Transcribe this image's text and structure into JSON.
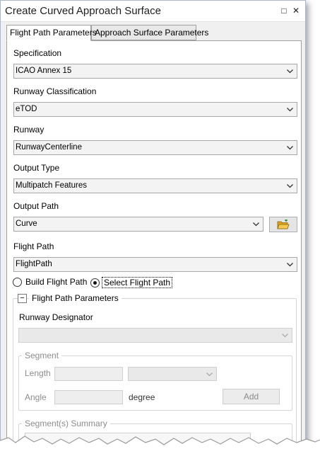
{
  "window": {
    "title": "Create Curved Approach Surface",
    "pin_glyph": "□",
    "close_glyph": "✕"
  },
  "tabs": [
    {
      "label": "Flight Path Parameters",
      "active": true
    },
    {
      "label": "Approach Surface Parameters",
      "active": false
    }
  ],
  "fields": {
    "specification": {
      "label": "Specification",
      "value": "ICAO Annex 15"
    },
    "runway_classification": {
      "label": "Runway Classification",
      "value": "eTOD"
    },
    "runway": {
      "label": "Runway",
      "value": "RunwayCenterline"
    },
    "output_type": {
      "label": "Output Type",
      "value": "Multipatch Features"
    },
    "output_path": {
      "label": "Output Path",
      "value": "Curve"
    },
    "flight_path": {
      "label": "Flight Path",
      "value": "FlightPath"
    }
  },
  "radio": {
    "build": {
      "label": "Build Flight Path",
      "checked": false
    },
    "select": {
      "label": "Select Flight Path",
      "checked": true
    }
  },
  "flight_path_parameters": {
    "title": "Flight Path Parameters",
    "collapse_glyph": "−",
    "runway_designator": {
      "label": "Runway Designator",
      "value": ""
    },
    "segment": {
      "title": "Segment",
      "length_label": "Length",
      "angle_label": "Angle",
      "angle_unit": "degree",
      "add_label": "Add"
    },
    "summary_title": "Segment(s) Summary"
  },
  "colors": {
    "folder_icon": "#e8b830",
    "disabled_text": "#8c8c8c"
  }
}
